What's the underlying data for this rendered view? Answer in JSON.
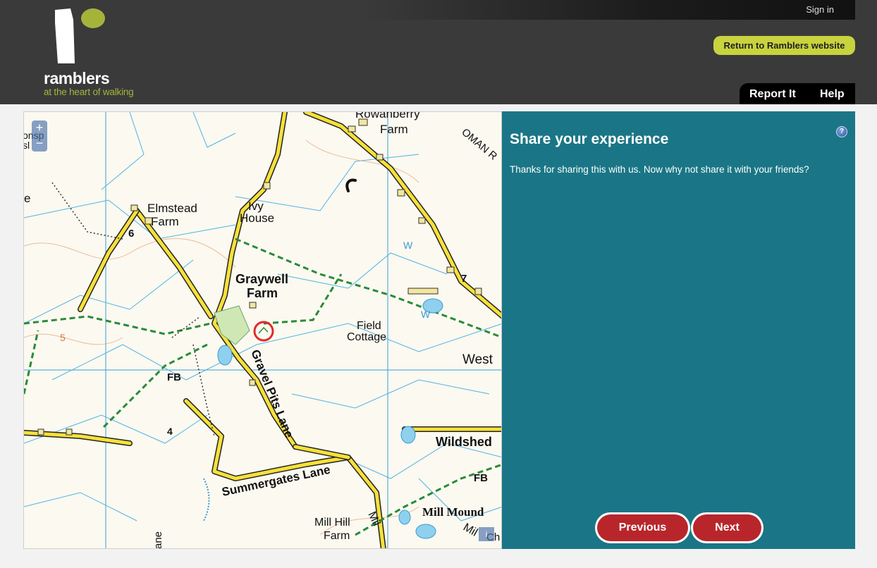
{
  "header": {
    "sign_in": "Sign in",
    "logo_word": "ramblers",
    "logo_tagline": "at the heart of walking",
    "return_button": "Return to Ramblers website",
    "nav": [
      {
        "label": "Report It"
      },
      {
        "label": "Help"
      }
    ]
  },
  "map": {
    "zoom_in": "+",
    "zoom_out": "−",
    "attribution_icon": "i",
    "labels": {
      "rowanberry": "Rowanberry",
      "farm_top": "Farm",
      "roman": "OMAN R",
      "elmstead": "Elmstead",
      "elmstead_farm": "Farm",
      "ivy": "Ivy",
      "house": "House",
      "graywell": "Graywell",
      "graywell_farm": "Farm",
      "field": "Field",
      "cottage": "Cottage",
      "west": "West",
      "gravel": "Gravel Pits Lane",
      "fb1": "FB",
      "fb2": "FB",
      "wildshed": "Wildshed",
      "summergates": "Summergates Lane",
      "mill_mound": "Mill Mound",
      "mill_hill": "Mill Hill",
      "mill_hill_farm": "Farm",
      "num6": "6",
      "num5": "5",
      "num4": "4",
      "num7": "7",
      "w1": "W",
      "w2": "W",
      "edge1": "e",
      "edge2": "onsp",
      "edge3": "sl",
      "lane": "ane",
      "mil": "Mil",
      "ch": "Ch"
    }
  },
  "panel": {
    "title": "Share your experience",
    "text": "Thanks for sharing this with us. Now why not share it with your friends?",
    "help_icon": "?",
    "previous": "Previous",
    "next": "Next"
  },
  "colors": {
    "header_bg": "#3a3a3a",
    "accent_green": "#c8d33e",
    "panel_teal": "#1a7686",
    "button_red": "#b8262b"
  }
}
